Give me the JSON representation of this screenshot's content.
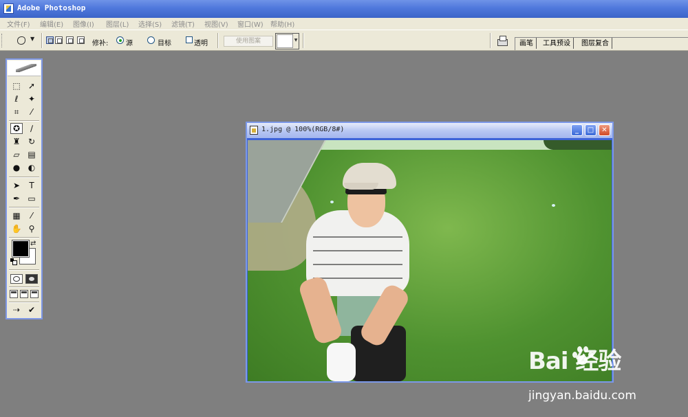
{
  "app": {
    "title": "Adobe Photoshop"
  },
  "menu": [
    "文件(F)",
    "编辑(E)",
    "图像(I)",
    "图层(L)",
    "选择(S)",
    "滤镜(T)",
    "视图(V)",
    "窗口(W)",
    "帮助(H)"
  ],
  "options": {
    "patch_label": "修补:",
    "source_label": "源",
    "destination_label": "目标",
    "transparent_label": "透明",
    "use_pattern_label": "使用图案",
    "source_checked": true,
    "transparent_checked": false
  },
  "palette_well": {
    "tabs": [
      "画笔",
      "工具预设",
      "图层复合"
    ]
  },
  "document": {
    "title": "1.jpg @ 100%(RGB/8#)"
  },
  "colors": {
    "foreground": "#000000",
    "background": "#ffffff",
    "accent": "#3d63d8"
  },
  "watermark": {
    "logo": "Bai 经验",
    "url": "jingyan.baidu.com"
  }
}
